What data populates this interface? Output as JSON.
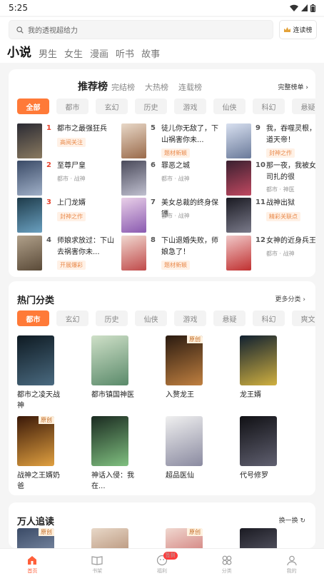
{
  "status": {
    "time": "5:25"
  },
  "search": {
    "placeholder": "我的透视超给力",
    "readlist": "连读榜"
  },
  "top_tabs": [
    "小说",
    "男生",
    "女生",
    "漫画",
    "听书",
    "故事"
  ],
  "rank": {
    "title": "推荐榜",
    "subtabs": [
      "完结榜",
      "大热榜",
      "连载榜"
    ],
    "more": "完整榜单",
    "chips": [
      "全部",
      "都市",
      "玄幻",
      "历史",
      "游戏",
      "仙侠",
      "科幻",
      "悬疑"
    ],
    "books": [
      {
        "num": "1",
        "title": "都市之最强狂兵",
        "tag": "高阅关注",
        "meta": ""
      },
      {
        "num": "2",
        "title": "至尊尸皇",
        "tag": "",
        "meta": "都市 · 战神"
      },
      {
        "num": "3",
        "title": "上门龙婿",
        "tag": "封神之作",
        "meta": ""
      },
      {
        "num": "4",
        "title": "师娘求放过：下山去祸害你未...",
        "tag": "开展爆彩",
        "meta": ""
      },
      {
        "num": "5",
        "title": "徒儿你无敌了，下山祸害你未...",
        "tag": "题材新颖",
        "meta": ""
      },
      {
        "num": "6",
        "title": "罪恶之城",
        "tag": "",
        "meta": "都市 · 战神"
      },
      {
        "num": "7",
        "title": "美女总裁的终身保镖",
        "tag": "",
        "meta": "都市 · 战神"
      },
      {
        "num": "8",
        "title": "下山退婚失败，师娘急了！",
        "tag": "题材新颖",
        "meta": ""
      },
      {
        "num": "9",
        "title": "我，吞噬灵根，证道天帝！",
        "tag": "封神之作",
        "meta": ""
      },
      {
        "num": "10",
        "title": "那一夜，我被女上司扎的很",
        "tag": "",
        "meta": "都市 · 神医"
      },
      {
        "num": "11",
        "title": "战神出狱",
        "tag": "精彩关联点",
        "meta": ""
      },
      {
        "num": "12",
        "title": "女神的近身兵王",
        "tag": "",
        "meta": "都市 · 战神"
      }
    ]
  },
  "hot": {
    "title": "热门分类",
    "more": "更多分类",
    "chips": [
      "都市",
      "玄幻",
      "历史",
      "仙侠",
      "游戏",
      "悬疑",
      "科幻",
      "爽文"
    ],
    "books": [
      {
        "title": "都市之凌天战神",
        "badge": ""
      },
      {
        "title": "都市镇国神医",
        "badge": ""
      },
      {
        "title": "入赘龙王",
        "badge": "原创"
      },
      {
        "title": "龙王婿",
        "badge": ""
      },
      {
        "title": "战神之王婿奶爸",
        "badge": "原创"
      },
      {
        "title": "神话入侵：我在...",
        "badge": ""
      },
      {
        "title": "超品医仙",
        "badge": ""
      },
      {
        "title": "代号修罗",
        "badge": ""
      }
    ]
  },
  "follow": {
    "title": "万人追读",
    "more": "换一换",
    "badges": [
      "原创",
      "",
      "原创",
      ""
    ]
  },
  "bottom_tabs": [
    {
      "label": "首页",
      "active": true
    },
    {
      "label": "书架",
      "active": false
    },
    {
      "label": "福利",
      "active": false,
      "badge": "签到"
    },
    {
      "label": "分类",
      "active": false
    },
    {
      "label": "我的",
      "active": false
    }
  ],
  "colors": {
    "accent": "#ff7a38",
    "rank_red": "#e8452f",
    "rank_gray": "#555555"
  }
}
